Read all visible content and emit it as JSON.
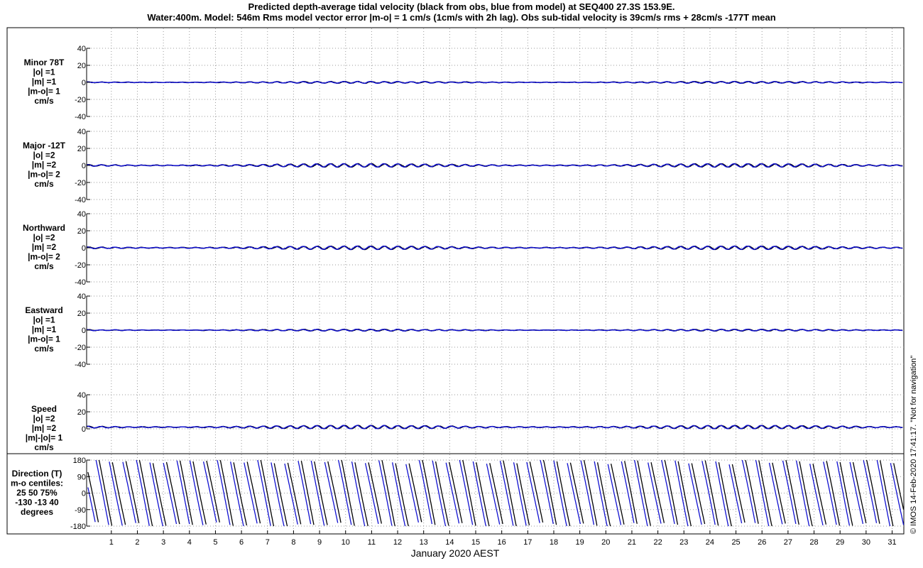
{
  "title_lines": [
    "Predicted depth-average tidal velocity (black from obs, blue from model) at SEQ400 27.3S 153.9E.",
    "Water:400m. Model: 546m  Rms model vector error |m-o| = 1 cm/s (1cm/s with 2h lag). Obs sub-tidal velocity is 39cm/s rms + 28cm/s -177T mean"
  ],
  "credit": "© IMOS 14-Feb-2020 17:41:17. \"Not for navigation\"",
  "colors": {
    "obs": "#000000",
    "model": "#1010d0",
    "grid": "#9a9a9a"
  },
  "chart_data": {
    "type": "line",
    "xlabel": "January 2020 AEST",
    "x_ticks": [
      1,
      2,
      3,
      4,
      5,
      6,
      7,
      8,
      9,
      10,
      11,
      12,
      13,
      14,
      15,
      16,
      17,
      18,
      19,
      20,
      21,
      22,
      23,
      24,
      25,
      26,
      27,
      28,
      29,
      30,
      31
    ],
    "xlim": [
      0.05,
      31.45
    ],
    "grid": true,
    "series_legend": {
      "obs": "black from obs",
      "model": "blue from model"
    },
    "panels": [
      {
        "labels": [
          "Minor 78T",
          "|o| =1",
          "|m| =1",
          "|m-o|= 1",
          "cm/s"
        ],
        "ylim": [
          -40,
          40
        ],
        "yticks": [
          -40,
          -20,
          0,
          20,
          40
        ],
        "obs_amplitude": 1,
        "model_amplitude": 1,
        "mean": 0
      },
      {
        "labels": [
          "Major -12T",
          "|o| =2",
          "|m| =2",
          "|m-o|= 2",
          "cm/s"
        ],
        "ylim": [
          -40,
          40
        ],
        "yticks": [
          -40,
          -20,
          0,
          20,
          40
        ],
        "obs_amplitude": 2,
        "model_amplitude": 2,
        "mean": 0
      },
      {
        "labels": [
          "Northward",
          "|o| =2",
          "|m| =2",
          "|m-o|= 2",
          "cm/s"
        ],
        "ylim": [
          -40,
          40
        ],
        "yticks": [
          -40,
          -20,
          0,
          20,
          40
        ],
        "obs_amplitude": 2,
        "model_amplitude": 2,
        "mean": 0
      },
      {
        "labels": [
          "Eastward",
          "|o| =1",
          "|m| =1",
          "|m-o|= 1",
          "cm/s"
        ],
        "ylim": [
          -40,
          40
        ],
        "yticks": [
          -40,
          -20,
          0,
          20,
          40
        ],
        "obs_amplitude": 1,
        "model_amplitude": 1,
        "mean": 0
      },
      {
        "labels": [
          "Speed",
          "|o| =2",
          "|m| =2",
          "|m|-|o|= 1",
          "cm/s"
        ],
        "ylim": [
          0,
          40
        ],
        "yticks": [
          0,
          20,
          40
        ],
        "obs_amplitude": 2,
        "model_amplitude": 2,
        "mean": 2
      },
      {
        "labels": [
          "Direction (T)",
          "m-o centiles:",
          "25  50  75%",
          "-130  -13   40",
          "degrees"
        ],
        "ylim": [
          -180,
          180
        ],
        "yticks": [
          -180,
          -90,
          0,
          90,
          180
        ],
        "direction": true
      }
    ]
  }
}
